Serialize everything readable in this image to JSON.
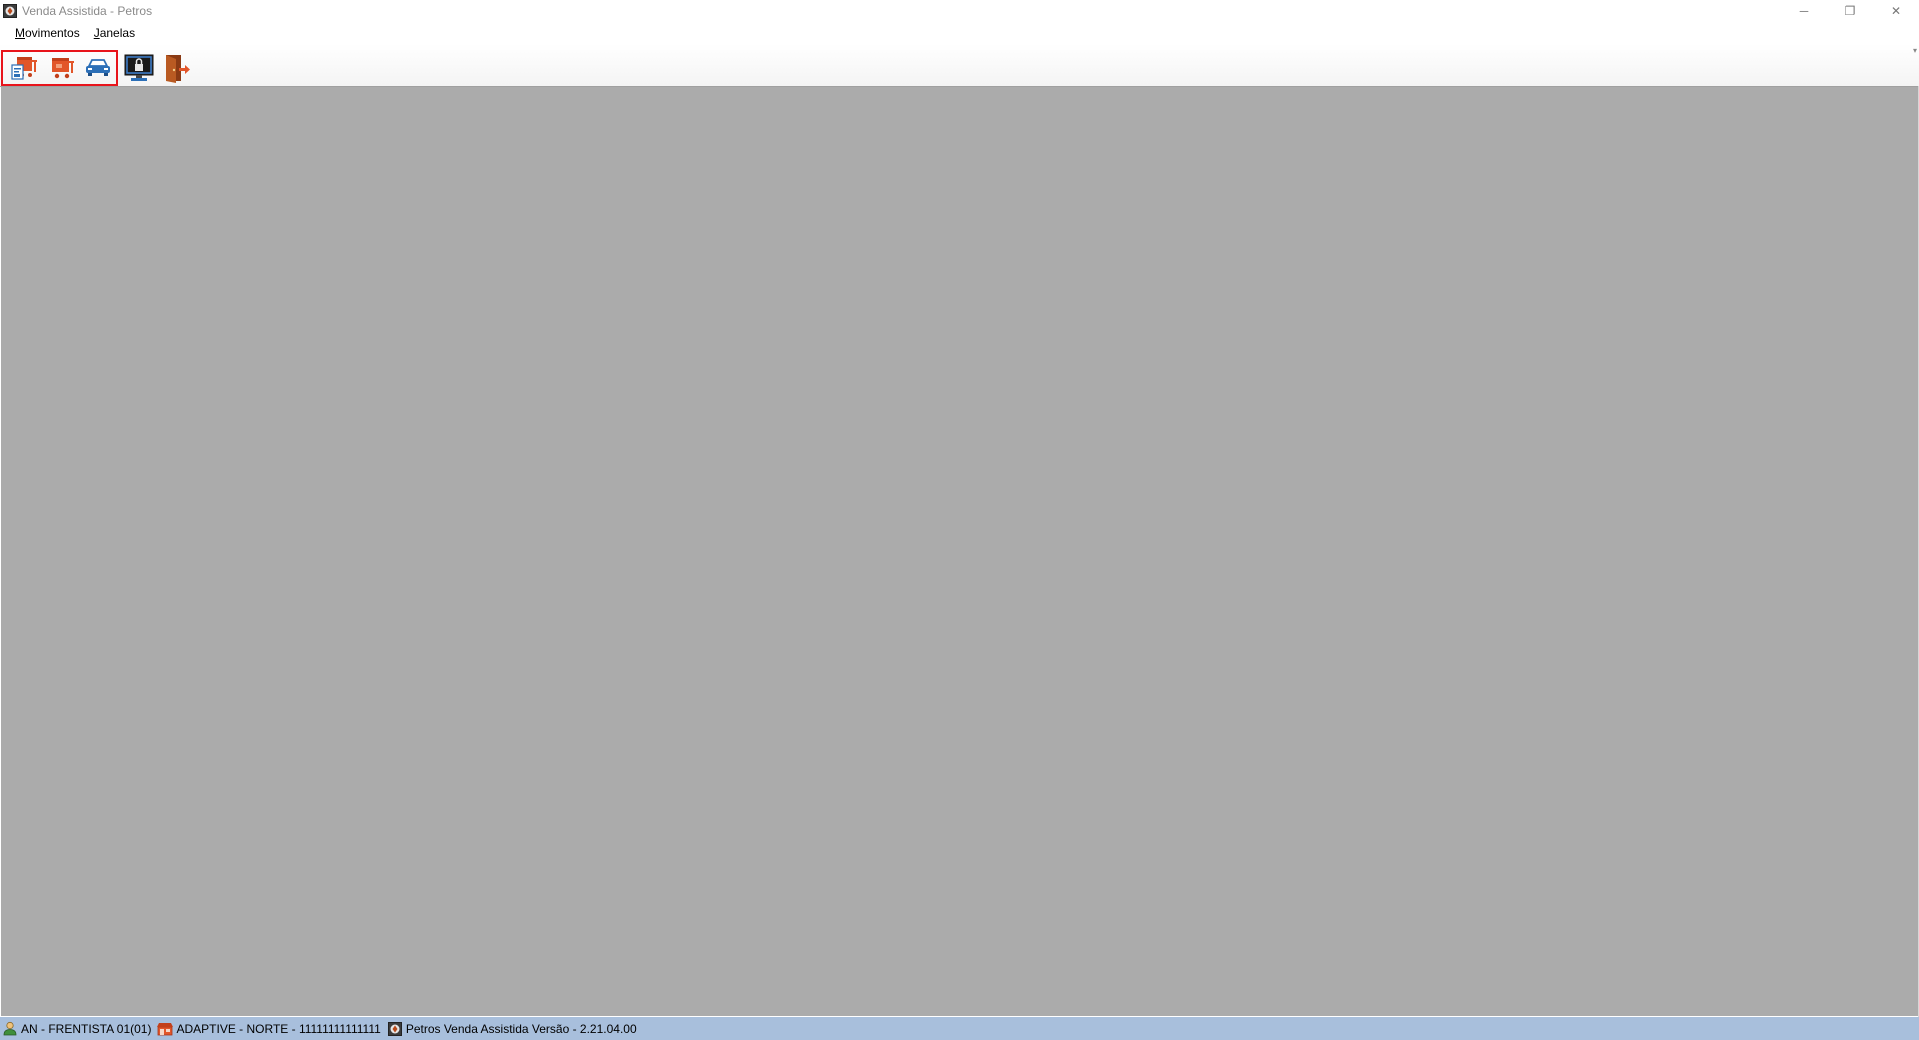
{
  "window": {
    "title": "Venda Assistida - Petros",
    "controls": {
      "minimize": "─",
      "restore": "❐",
      "close": "✕"
    }
  },
  "menu": {
    "items": [
      {
        "label": "Movimentos"
      },
      {
        "label": "Janelas"
      }
    ]
  },
  "toolbar": {
    "buttons": [
      {
        "icon": "new-sale-icon"
      },
      {
        "icon": "store-cart-icon"
      },
      {
        "icon": "car-icon"
      },
      {
        "icon": "lock-screen-icon"
      },
      {
        "icon": "exit-door-icon"
      }
    ]
  },
  "statusbar": {
    "user": "AN - FRENTISTA 01(01)",
    "company": "ADAPTIVE - NORTE - 11111111111111",
    "version": "Petros Venda Assistida Versão - 2.21.04.00"
  },
  "colors": {
    "mdi_background": "#ababab",
    "statusbar_background": "#a8bfdc",
    "highlight_border": "#e8141b",
    "accent_orange": "#e2562a"
  }
}
